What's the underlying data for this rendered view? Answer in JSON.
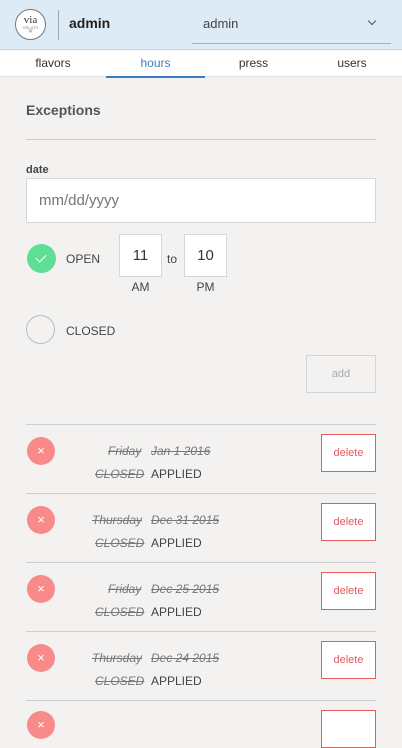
{
  "header": {
    "logo": {
      "main": "via",
      "sub": "GELATO",
      "fork": "Ψ"
    },
    "title": "admin",
    "select_value": "admin"
  },
  "tabs": [
    {
      "label": "flavors"
    },
    {
      "label": "hours",
      "active": true
    },
    {
      "label": "press"
    },
    {
      "label": "users"
    }
  ],
  "exceptions": {
    "title": "Exceptions",
    "date_label": "date",
    "date_placeholder": "mm/dd/yyyy",
    "open_label": "OPEN",
    "closed_label": "CLOSED",
    "open_time": "11",
    "open_period": "AM",
    "to_label": "to",
    "close_time": "10",
    "close_period": "PM",
    "add_label": "add"
  },
  "list": [
    {
      "day": "Friday",
      "date": "Jan 1 2016",
      "type": "CLOSED",
      "status": "APPLIED",
      "delete_label": "delete",
      "remove_glyph": "×"
    },
    {
      "day": "Thursday",
      "date": "Dec 31 2015",
      "type": "CLOSED",
      "status": "APPLIED",
      "delete_label": "delete",
      "remove_glyph": "×"
    },
    {
      "day": "Friday",
      "date": "Dec 25 2015",
      "type": "CLOSED",
      "status": "APPLIED",
      "delete_label": "delete",
      "remove_glyph": "×"
    },
    {
      "day": "Thursday",
      "date": "Dec 24 2015",
      "type": "CLOSED",
      "status": "APPLIED",
      "delete_label": "delete",
      "remove_glyph": "×"
    },
    {
      "remove_glyph": "×",
      "delete_label": ""
    }
  ],
  "colors": {
    "accent": "#3b7dbf",
    "open": "#5fdf95",
    "danger": "#e55a5a",
    "header_bg": "#ddebf7"
  }
}
